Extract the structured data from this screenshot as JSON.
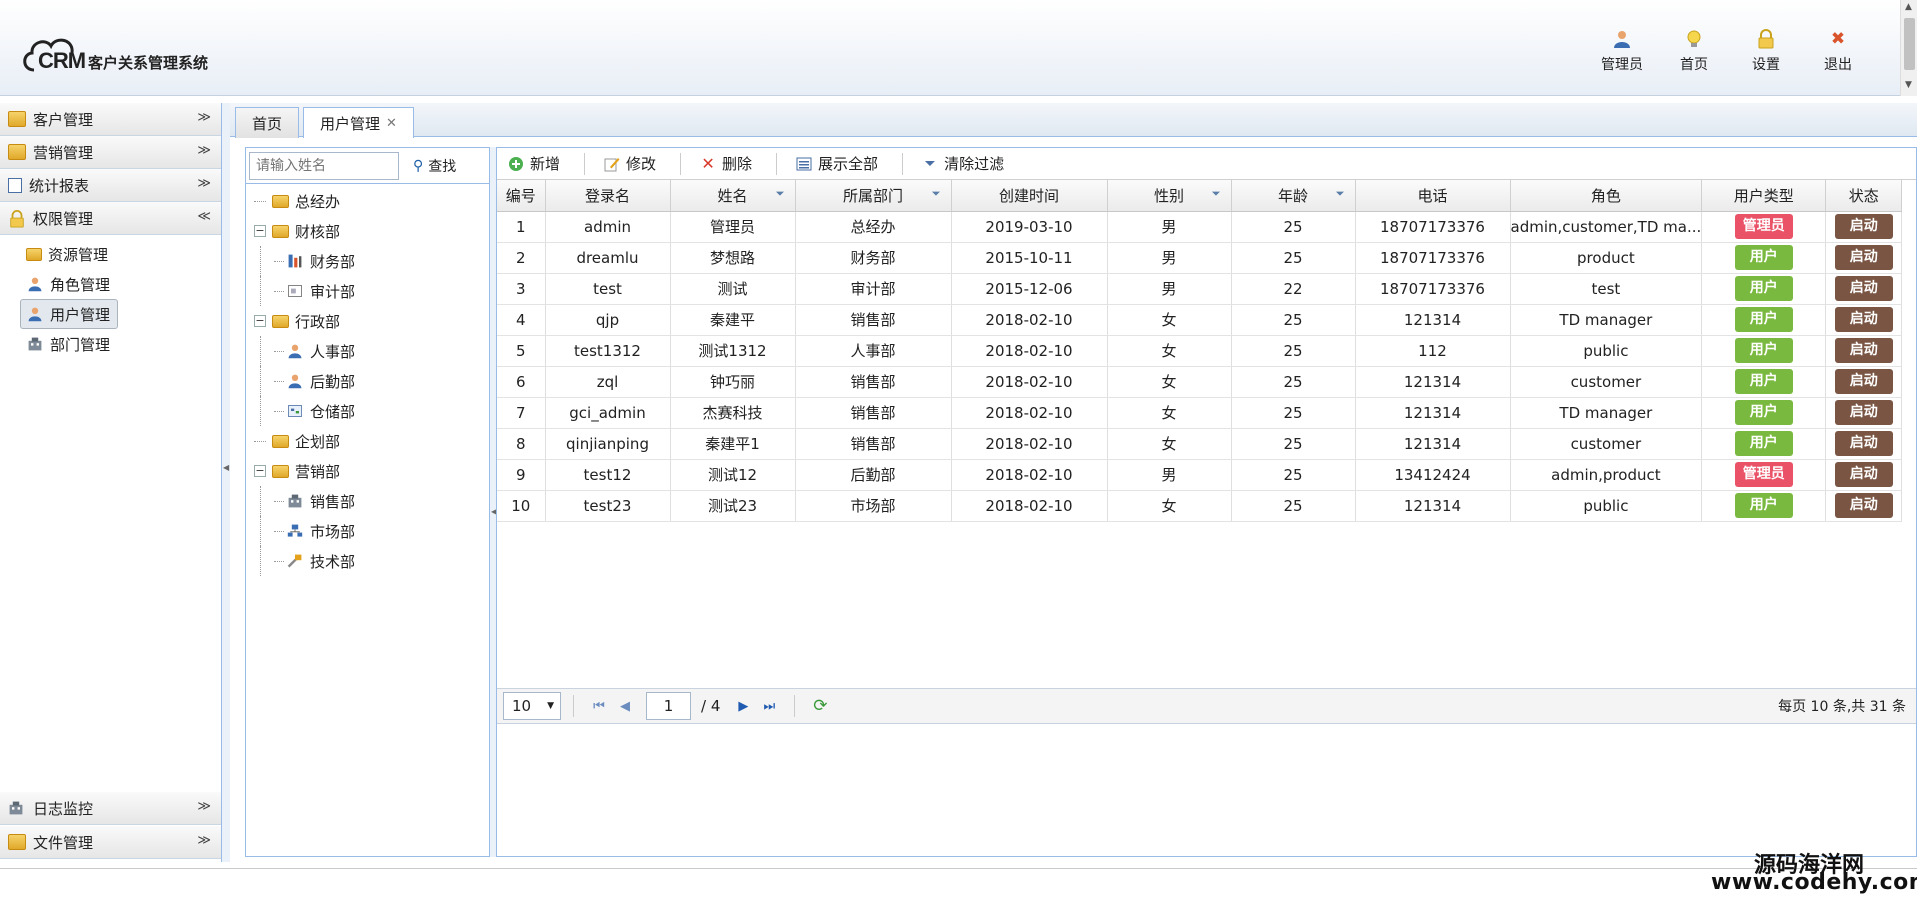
{
  "header": {
    "logo_text": "CRM",
    "title": "客户关系管理系统",
    "actions": [
      {
        "label": "管理员",
        "icon": "user-icon"
      },
      {
        "label": "首页",
        "icon": "lightbulb-icon"
      },
      {
        "label": "设置",
        "icon": "lock-icon"
      },
      {
        "label": "退出",
        "icon": "close-icon"
      }
    ]
  },
  "sidebar": {
    "sections": [
      {
        "label": "客户管理",
        "icon": "folder-icon"
      },
      {
        "label": "营销管理",
        "icon": "folder-icon"
      },
      {
        "label": "统计报表",
        "icon": "report-icon"
      },
      {
        "label": "权限管理",
        "icon": "lock-icon"
      }
    ],
    "sub_items": [
      {
        "label": "资源管理",
        "icon": "folder-icon"
      },
      {
        "label": "角色管理",
        "icon": "user-icon"
      },
      {
        "label": "用户管理",
        "icon": "user-icon"
      },
      {
        "label": "部门管理",
        "icon": "building-icon"
      }
    ],
    "bottom_sections": [
      {
        "label": "日志监控",
        "icon": "building-icon"
      },
      {
        "label": "文件管理",
        "icon": "folder-icon"
      }
    ]
  },
  "tabs": [
    {
      "label": "首页"
    },
    {
      "label": "用户管理",
      "close": "✕"
    }
  ],
  "tree": {
    "search_placeholder": "请输入姓名",
    "search_label": "查找",
    "nodes": [
      {
        "label": "总经办",
        "level": 0,
        "toggle": ""
      },
      {
        "label": "财核部",
        "level": 0,
        "toggle": "−"
      },
      {
        "label": "财务部",
        "level": 1,
        "toggle": ""
      },
      {
        "label": "审计部",
        "level": 1,
        "toggle": ""
      },
      {
        "label": "行政部",
        "level": 0,
        "toggle": "−"
      },
      {
        "label": "人事部",
        "level": 1,
        "toggle": ""
      },
      {
        "label": "后勤部",
        "level": 1,
        "toggle": ""
      },
      {
        "label": "仓储部",
        "level": 1,
        "toggle": ""
      },
      {
        "label": "企划部",
        "level": 0,
        "toggle": ""
      },
      {
        "label": "营销部",
        "level": 0,
        "toggle": "−"
      },
      {
        "label": "销售部",
        "level": 1,
        "toggle": ""
      },
      {
        "label": "市场部",
        "level": 1,
        "toggle": ""
      },
      {
        "label": "技术部",
        "level": 1,
        "toggle": ""
      }
    ]
  },
  "toolbar": {
    "add": "新增",
    "edit": "修改",
    "delete": "删除",
    "show_all": "展示全部",
    "clear_filter": "清除过滤"
  },
  "grid": {
    "columns": [
      "编号",
      "登录名",
      "姓名",
      "所属部门",
      "创建时间",
      "性别",
      "年龄",
      "电话",
      "角色",
      "用户类型",
      "状态"
    ],
    "rows": [
      [
        "1",
        "admin",
        "管理员",
        "总经办",
        "2019-03-10",
        "男",
        "25",
        "18707173376",
        "admin,customer,TD ma...",
        "管理员",
        "启动"
      ],
      [
        "2",
        "dreamlu",
        "梦想路",
        "财务部",
        "2015-10-11",
        "男",
        "25",
        "18707173376",
        "product",
        "用户",
        "启动"
      ],
      [
        "3",
        "test",
        "测试",
        "审计部",
        "2015-12-06",
        "男",
        "22",
        "18707173376",
        "test",
        "用户",
        "启动"
      ],
      [
        "4",
        "qjp",
        "秦建平",
        "销售部",
        "2018-02-10",
        "女",
        "25",
        "121314",
        "TD manager",
        "用户",
        "启动"
      ],
      [
        "5",
        "test1312",
        "测试1312",
        "人事部",
        "2018-02-10",
        "女",
        "25",
        "112",
        "public",
        "用户",
        "启动"
      ],
      [
        "6",
        "zql",
        "钟巧丽",
        "销售部",
        "2018-02-10",
        "女",
        "25",
        "121314",
        "customer",
        "用户",
        "启动"
      ],
      [
        "7",
        "gci_admin",
        "杰赛科技",
        "销售部",
        "2018-02-10",
        "女",
        "25",
        "121314",
        "TD manager",
        "用户",
        "启动"
      ],
      [
        "8",
        "qinjianping",
        "秦建平1",
        "销售部",
        "2018-02-10",
        "女",
        "25",
        "121314",
        "customer",
        "用户",
        "启动"
      ],
      [
        "9",
        "test12",
        "测试12",
        "后勤部",
        "2018-02-10",
        "男",
        "25",
        "13412424",
        "admin,product",
        "管理员",
        "启动"
      ],
      [
        "10",
        "test23",
        "测试23",
        "市场部",
        "2018-02-10",
        "女",
        "25",
        "121314",
        "public",
        "用户",
        "启动"
      ]
    ]
  },
  "pager": {
    "page_size": "10",
    "current_page": "1",
    "total_pages": "/ 4",
    "info": "每页 10 条,共 31 条"
  },
  "colors": {
    "admin_badge": "#e95267",
    "user_badge": "#7ab93f",
    "status_button": "#7a5543",
    "border_blue": "#99bbe8"
  },
  "watermark": {
    "line1": "源码海洋网",
    "line2": "www.codehy.com"
  }
}
